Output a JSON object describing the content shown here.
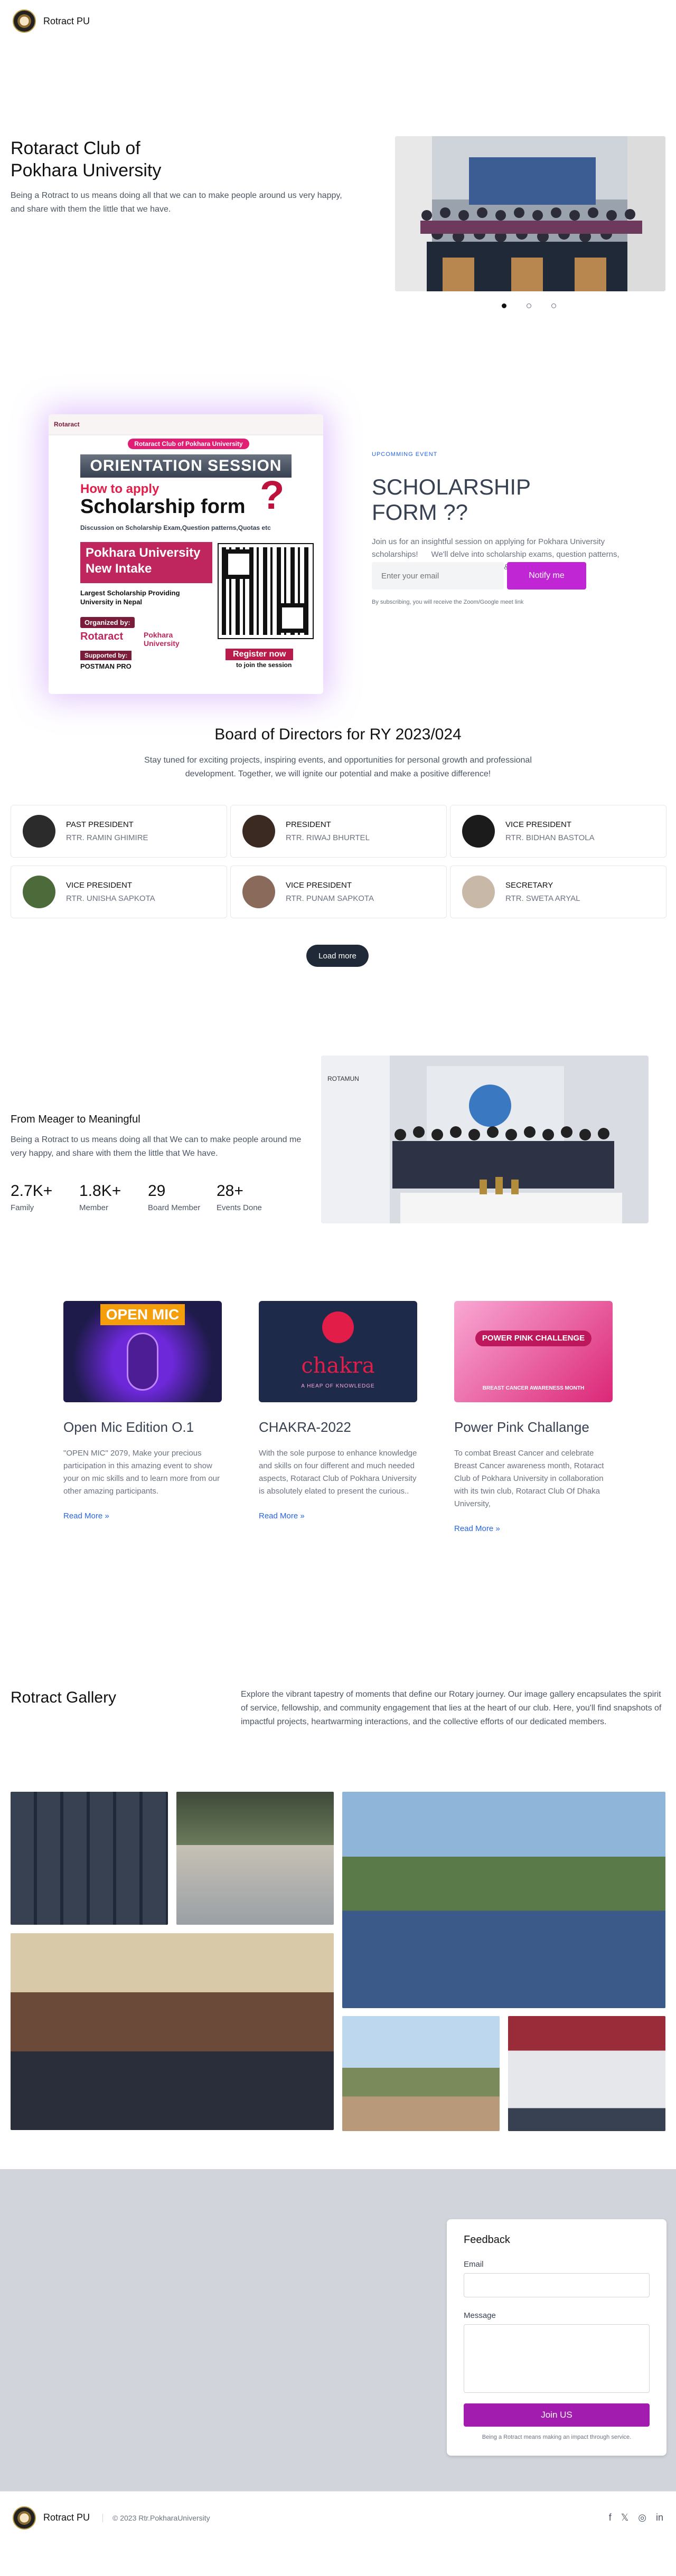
{
  "header": {
    "brand": "Rotract PU"
  },
  "hero": {
    "title_line1": "Rotaract Club of",
    "title_line2": "Pokhara University",
    "text": "Being a Rotract to us means doing all that we can to make people around us very happy, and share with them the little that we have."
  },
  "event": {
    "tag": "UPCOMMING EVENT",
    "title_line1": "SCHOLARSHIP",
    "title_line2": "FORM ??",
    "desc": "Join us for an insightful session on applying for Pokhara University scholarships!      We'll delve into scholarship exams, question patterns, quotas, and address all your queries. &",
    "email_placeholder": "Enter your email",
    "notify_label": "Notify me",
    "note": "By subscribing, you will receive the Zoom/Google meet link",
    "poster": {
      "header_text": "Rotaract Club of Pokhara University",
      "pill": "Rotaract Club of Pokhara University",
      "orientation": "ORIENTATION SESSION",
      "how": "How to apply",
      "scholarship": "Scholarship form",
      "question_mark": "?",
      "discussion": "Discussion on Scholarship Exam,Question patterns,Quotas etc",
      "pu_line1": "Pokhara University",
      "pu_line2": "New Intake",
      "largest": "Largest Scholarship Providing University in Nepal",
      "organized": "Organized by:",
      "rotaract": "Rotaract",
      "pokhara_line1": "Pokhara",
      "pokhara_line2": "University",
      "supported": "Supported by:",
      "postman": "POSTMAN PRO",
      "register": "Register now",
      "join": "to join the session"
    }
  },
  "board": {
    "title": "Board of Directors for RY 2023/024",
    "subtitle": "Stay tuned for exciting projects, inspiring events, and opportunities for personal growth and professional development. Together, we will ignite our potential and make a positive difference!",
    "members": [
      {
        "role": "PAST PRESIDENT",
        "name": "RTR. RAMIN GHIMIRE",
        "avatar_color": "#2b2b2b"
      },
      {
        "role": "PRESIDENT",
        "name": "RTR. RIWAJ BHURTEL",
        "avatar_color": "#3a2a22"
      },
      {
        "role": "VICE PRESIDENT",
        "name": "RTR. BIDHAN BASTOLA",
        "avatar_color": "#1b1b1b"
      },
      {
        "role": "VICE PRESIDENT",
        "name": "RTR. UNISHA SAPKOTA",
        "avatar_color": "#4d6b3a"
      },
      {
        "role": "VICE PRESIDENT",
        "name": "RTR. PUNAM SAPKOTA",
        "avatar_color": "#8a6a5a"
      },
      {
        "role": "SECRETARY",
        "name": "RTR. SWETA ARYAL",
        "avatar_color": "#c8b8a8"
      }
    ],
    "load_more": "Load more"
  },
  "meager": {
    "title": "From Meager to Meaningful",
    "text": "Being a Rotract to us means doing all that We can to make people around me very happy, and share with them the little that We have.",
    "stats": [
      {
        "value": "2.7K+",
        "label": "Family"
      },
      {
        "value": "1.8K+",
        "label": "Member"
      },
      {
        "value": "29",
        "label": "Board Member"
      },
      {
        "value": "28+",
        "label": "Events Done"
      }
    ],
    "img_label": "ROTAMUN"
  },
  "events": [
    {
      "title": "Open Mic Edition O.1",
      "text": "\"OPEN MIC\" 2079, Make your precious participation in this amazing event to show your on mic skills and to learn more from our other amazing participants.",
      "link": "Read More »",
      "thumb_text": "OPEN MIC"
    },
    {
      "title": "CHAKRA-2022",
      "text": "With the sole purpose to enhance knowledge and skills on four different and much needed aspects, Rotaract Club of Pokhara University is absolutely elated to present the curious..",
      "link": "Read More »",
      "thumb_text": "chakra",
      "thumb_sub": "A HEAP OF KNOWLEDGE"
    },
    {
      "title": "Power Pink Challange",
      "text": "To combat Breast Cancer and celebrate Breast Cancer awareness month, Rotaract Club of Pokhara University in collaboration with its twin club, Rotaract Club Of Dhaka University,",
      "link": "Read More »",
      "thumb_text": "POWER PINK CHALLENGE",
      "thumb_sub": "BREAST CANCER AWARENESS MONTH"
    }
  ],
  "gallery": {
    "title": "Rotract Gallery",
    "text": "Explore the vibrant tapestry of moments that define our Rotary journey. Our image gallery encapsulates the spirit of service, fellowship, and community engagement that lies at the heart of our club. Here, you'll find snapshots of impactful projects, heartwarming interactions, and the collective efforts of our dedicated members."
  },
  "feedback": {
    "title": "Feedback",
    "email_label": "Email",
    "message_label": "Message",
    "submit": "Join US",
    "note": "Being a Rotract means making an impact through service."
  },
  "footer": {
    "brand": "Rotract PU",
    "copyright": "© 2023 Rtr.PokharaUniversity",
    "socials": [
      "f",
      "𝕏",
      "◎",
      "in"
    ]
  }
}
